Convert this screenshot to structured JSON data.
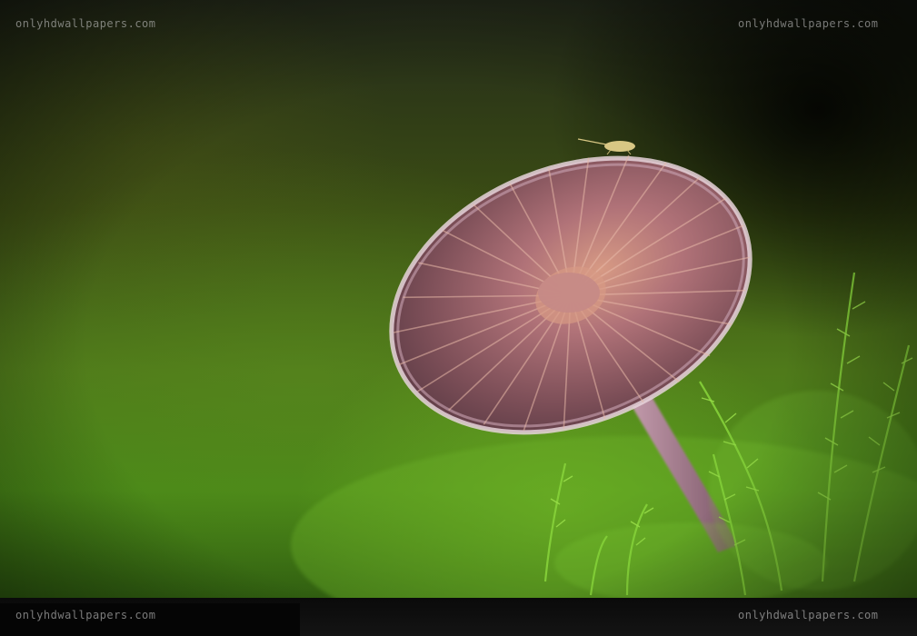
{
  "watermarks": {
    "top_left": "onlyhdwallpapers.com",
    "top_right": "onlyhdwallpapers.com",
    "bottom_left": "onlyhdwallpapers.com",
    "bottom_right": "onlyhdwallpapers.com"
  },
  "colors": {
    "cap": "#b78a95",
    "gills": "#8e5c5e",
    "stem": "#b48a9c",
    "moss": "#7cc832",
    "background": "#3f6a16"
  }
}
